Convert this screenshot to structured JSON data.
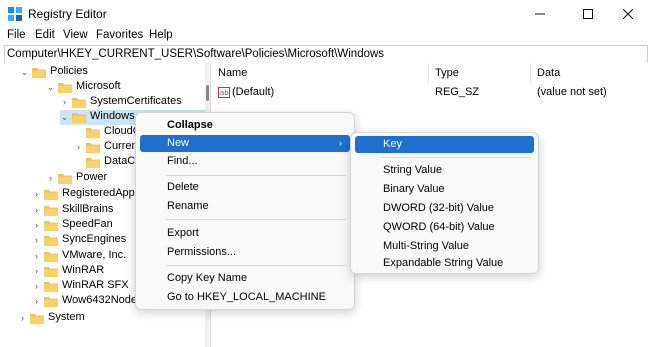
{
  "window": {
    "title": "Registry Editor",
    "minimize_icon": "minimize-icon",
    "maximize_icon": "maximize-icon",
    "close_icon": "close-icon"
  },
  "menu": [
    "File",
    "Edit",
    "View",
    "Favorites",
    "Help"
  ],
  "address": "Computer\\HKEY_CURRENT_USER\\Software\\Policies\\Microsoft\\Windows",
  "tree": [
    {
      "label": "Policies",
      "chev": "⌄"
    },
    {
      "label": "Microsoft",
      "chev": "⌄"
    },
    {
      "label": "SystemCertificates",
      "chev": "›"
    },
    {
      "label": "Windows",
      "chev": "⌄",
      "selected": true
    },
    {
      "label": "CloudC",
      "chev": ""
    },
    {
      "label": "Curren",
      "chev": "›"
    },
    {
      "label": "DataCo",
      "chev": ""
    },
    {
      "label": "Power",
      "chev": "›"
    },
    {
      "label": "RegisteredAppli",
      "chev": "›"
    },
    {
      "label": "SkillBrains",
      "chev": "›"
    },
    {
      "label": "SpeedFan",
      "chev": "›"
    },
    {
      "label": "SyncEngines",
      "chev": "›"
    },
    {
      "label": "VMware, Inc.",
      "chev": "›"
    },
    {
      "label": "WinRAR",
      "chev": "›"
    },
    {
      "label": "WinRAR SFX",
      "chev": "›"
    },
    {
      "label": "Wow6432Node",
      "chev": "›"
    },
    {
      "label": "System",
      "chev": "›"
    }
  ],
  "columns": {
    "name": "Name",
    "type": "Type",
    "data": "Data"
  },
  "values": [
    {
      "name": "(Default)",
      "type": "REG_SZ",
      "data": "(value not set)",
      "icon": "string-value-icon"
    }
  ],
  "context_menu": [
    "Collapse",
    "New",
    "Find...",
    "Delete",
    "Rename",
    "Export",
    "Permissions...",
    "Copy Key Name",
    "Go to HKEY_LOCAL_MACHINE"
  ],
  "submenu": [
    "Key",
    "String Value",
    "Binary Value",
    "DWORD (32-bit) Value",
    "QWORD (64-bit) Value",
    "Multi-String Value",
    "Expandable String Value"
  ],
  "colors": {
    "accent": "#1f6fd1",
    "folder": "#f2c14e",
    "selection": "#cce4f7"
  }
}
